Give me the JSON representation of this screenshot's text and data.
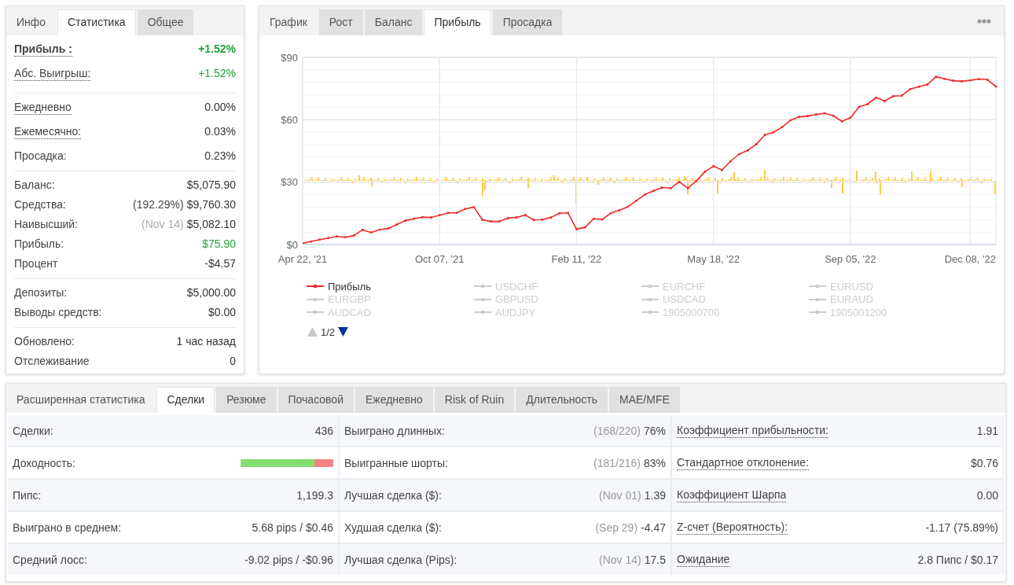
{
  "stats_panel": {
    "tabs": [
      {
        "label": "Инфо",
        "kind": "label",
        "selected": false
      },
      {
        "label": "Статистика",
        "kind": "tab",
        "selected": true
      },
      {
        "label": "Общее",
        "kind": "tab",
        "selected": false
      }
    ],
    "sections": [
      {
        "rows": [
          {
            "label": "Прибыль :",
            "value": "+1.52%",
            "positive": true,
            "bold": true,
            "underlined": true
          },
          {
            "label": "Абс. Выигрыш:",
            "value": "+1.52%",
            "positive": true,
            "bold": false,
            "underlined": true
          }
        ]
      },
      {
        "rows": [
          {
            "label": "Ежедневно",
            "value": "0.00%",
            "positive": false,
            "bold": false,
            "underlined": true
          },
          {
            "label": "Ежемесячно:",
            "value": "0.03%",
            "positive": false,
            "bold": false,
            "underlined": true
          },
          {
            "label": "Просадка:",
            "value": "0.23%",
            "positive": false,
            "bold": false,
            "underlined": false
          }
        ]
      },
      {
        "rows": [
          {
            "label": "Баланс:",
            "value": "$5,075.90",
            "positive": false,
            "bold": false,
            "underlined": false
          },
          {
            "label": "Средства:",
            "note": "(192.29%)",
            "note_muted": false,
            "value": "$9,760.30",
            "positive": false,
            "bold": false,
            "underlined": false
          },
          {
            "label": "Наивысший:",
            "note": "(Nov 14)",
            "note_muted": true,
            "value": "$5,082.10",
            "positive": false,
            "bold": false,
            "underlined": false
          },
          {
            "label": "Прибыль:",
            "value": "$75.90",
            "positive": true,
            "bold": false,
            "underlined": false
          },
          {
            "label": "Процент",
            "value": "-$4.57",
            "positive": false,
            "bold": false,
            "underlined": false
          }
        ]
      },
      {
        "rows": [
          {
            "label": "Депозиты:",
            "value": "$5,000.00",
            "positive": false,
            "bold": false,
            "underlined": false
          },
          {
            "label": "Выводы средств:",
            "value": "$0.00",
            "positive": false,
            "bold": false,
            "underlined": false
          }
        ]
      },
      {
        "rows": [
          {
            "label": "Обновлено:",
            "value": "1 час назад",
            "positive": false,
            "bold": false,
            "underlined": false
          },
          {
            "label": "Отслеживание",
            "value": "0",
            "positive": false,
            "bold": false,
            "underlined": false
          }
        ]
      }
    ]
  },
  "chart_panel": {
    "tabs": [
      {
        "label": "График",
        "kind": "label",
        "selected": false
      },
      {
        "label": "Рост",
        "kind": "tab",
        "selected": false
      },
      {
        "label": "Баланс",
        "kind": "tab",
        "selected": false
      },
      {
        "label": "Прибыль",
        "kind": "tab",
        "selected": true
      },
      {
        "label": "Просадка",
        "kind": "tab",
        "selected": false
      }
    ],
    "chart_data": {
      "type": "line",
      "grid": true,
      "categories": [
        "Apr 22, '21",
        null,
        null,
        null,
        null,
        null,
        null,
        null,
        null,
        null,
        null,
        null,
        null,
        null,
        null,
        null,
        "Oct 07, '21",
        null,
        null,
        null,
        null,
        null,
        null,
        null,
        null,
        null,
        null,
        null,
        null,
        null,
        null,
        null,
        "Feb 11, '22",
        null,
        null,
        null,
        null,
        null,
        null,
        null,
        null,
        null,
        null,
        null,
        null,
        null,
        null,
        null,
        "May 18, '22",
        null,
        null,
        null,
        null,
        null,
        null,
        null,
        null,
        null,
        null,
        null,
        null,
        null,
        null,
        null,
        "Sep 05, '22",
        null,
        null,
        null,
        null,
        null,
        null,
        null,
        null,
        null,
        null,
        null,
        null,
        null,
        "Dec 08, '22",
        null,
        null,
        null
      ],
      "series": [
        {
          "name": "Прибыль",
          "color": "#ee2b2b",
          "values": [
            0.6,
            1.5,
            2.4,
            3.1,
            3.9,
            3.5,
            4.3,
            7.1,
            5.8,
            7.2,
            7.7,
            9.6,
            11.5,
            12.4,
            13.2,
            13.0,
            14.1,
            15.2,
            15.2,
            17.1,
            18.0,
            11.9,
            11.1,
            11.1,
            12.7,
            13.1,
            14.2,
            11.8,
            12.0,
            13.0,
            15.0,
            15.2,
            7.4,
            8.3,
            12.4,
            12.1,
            15.1,
            16.5,
            18.2,
            21.1,
            24.1,
            25.8,
            27.4,
            27.1,
            30.2,
            27.1,
            30.6,
            35.0,
            37.7,
            35.8,
            40.1,
            43.5,
            45.3,
            48.2,
            52.7,
            54.0,
            56.4,
            59.8,
            61.4,
            61.8,
            62.6,
            63.1,
            61.9,
            59.3,
            61.0,
            66.2,
            67.5,
            70.7,
            69.0,
            71.4,
            71.6,
            74.8,
            75.9,
            77.0,
            80.7,
            79.7,
            78.8,
            78.5,
            79.0,
            79.6,
            79.3,
            76.0
          ]
        }
      ],
      "ylim": [
        0,
        90
      ],
      "yticks": [
        {
          "value": 0,
          "label": "$0"
        },
        {
          "value": 30,
          "label": "$30"
        },
        {
          "value": 60,
          "label": "$60"
        },
        {
          "value": 90,
          "label": "$90"
        }
      ]
    },
    "legend": {
      "items": [
        {
          "label": "USDCHF",
          "visible": false
        },
        {
          "label": "EURCHF",
          "visible": false
        },
        {
          "label": "EURUSD",
          "visible": false
        },
        {
          "label": "EURGBP",
          "visible": false
        },
        {
          "label": "GBPUSD",
          "visible": false
        },
        {
          "label": "USDCAD",
          "visible": false
        },
        {
          "label": "EURAUD",
          "visible": false
        },
        {
          "label": "AUDCAD",
          "visible": false
        },
        {
          "label": "AUDJPY",
          "visible": false
        },
        {
          "label": "1905000700",
          "visible": false
        },
        {
          "label": "1905001200",
          "visible": false
        }
      ],
      "pager": {
        "text": "1/2",
        "prev_disabled": true,
        "next_disabled": false
      }
    }
  },
  "details_panel": {
    "tabs": [
      {
        "label": "Расширенная статистика",
        "kind": "label",
        "selected": false
      },
      {
        "label": "Сделки",
        "kind": "tab",
        "selected": true
      },
      {
        "label": "Резюме",
        "kind": "tab",
        "selected": false
      },
      {
        "label": "Почасовой",
        "kind": "tab",
        "selected": false
      },
      {
        "label": "Ежедневно",
        "kind": "tab",
        "selected": false
      },
      {
        "label": "Risk of Ruin",
        "kind": "tab",
        "selected": false
      },
      {
        "label": "Длительность",
        "kind": "tab",
        "selected": false
      },
      {
        "label": "MAE/MFE",
        "kind": "tab",
        "selected": false
      }
    ],
    "rows": [
      {
        "cells": [
          {
            "kind": "text",
            "label": "Сделки:",
            "value": "436",
            "underlined": false
          },
          {
            "kind": "text",
            "label": "Выиграно длинных:",
            "note": "(168/220)",
            "value": "76%",
            "underlined": false
          },
          {
            "kind": "text",
            "label": "Коэффициент прибыльности:",
            "value": "1.91",
            "underlined": true
          }
        ]
      },
      {
        "cells": [
          {
            "kind": "bar",
            "label": "Доходность:",
            "level": 0.8,
            "underlined": false
          },
          {
            "kind": "text",
            "label": "Выигранные шорты:",
            "note": "(181/216)",
            "value": "83%",
            "underlined": false
          },
          {
            "kind": "text",
            "label": "Стандартное отклонение:",
            "value": "$0.76",
            "underlined": true
          }
        ]
      },
      {
        "cells": [
          {
            "kind": "text",
            "label": "Пипс:",
            "value": "1,199.3",
            "underlined": false
          },
          {
            "kind": "text",
            "label": "Лучшая сделка ($):",
            "note": "(Nov 01)",
            "value": "1.39",
            "underlined": false
          },
          {
            "kind": "text",
            "label": "Коэффициент Шарпа",
            "value": "0.00",
            "underlined": true
          }
        ]
      },
      {
        "cells": [
          {
            "kind": "text",
            "label": "Выиграно в среднем:",
            "value": "5.68 pips / $0.46",
            "underlined": false
          },
          {
            "kind": "text",
            "label": "Худшая сделка ($):",
            "note": "(Sep 29)",
            "value": "-4.47",
            "underlined": false
          },
          {
            "kind": "text",
            "label": "Z-счет (Вероятность):",
            "value": "-1.17 (75.89%)",
            "underlined": true
          }
        ]
      },
      {
        "cells": [
          {
            "kind": "text",
            "label": "Средний лосс:",
            "value": "-9.02 pips / -$0.96",
            "underlined": false
          },
          {
            "kind": "text",
            "label": "Лучшая сделка (Pips):",
            "note": "(Nov 14)",
            "value": "17.5",
            "underlined": false
          },
          {
            "kind": "text",
            "label": "Ожидание",
            "value": "2.8 Пипс / $0.17",
            "underlined": true
          }
        ]
      }
    ]
  }
}
